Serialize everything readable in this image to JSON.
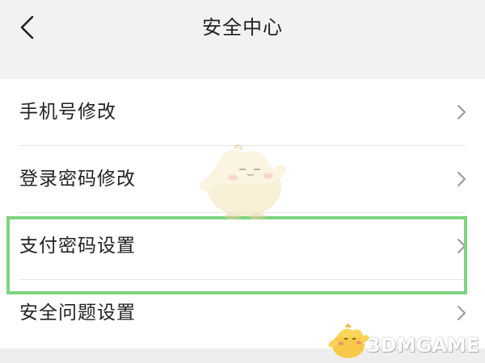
{
  "header": {
    "title": "安全中心",
    "back_icon": "chevron-left-icon"
  },
  "menu": {
    "items": [
      {
        "label": "手机号修改",
        "icon": "chevron-right-icon"
      },
      {
        "label": "登录密码修改",
        "icon": "chevron-right-icon"
      },
      {
        "label": "支付密码设置",
        "icon": "chevron-right-icon",
        "highlighted": true
      },
      {
        "label": "安全问题设置",
        "icon": "chevron-right-icon"
      }
    ]
  },
  "watermark": {
    "text": "3DMGAME"
  },
  "colors": {
    "background": "#f2f2f2",
    "row_background": "#ffffff",
    "highlight_border": "#7fd47f",
    "chevron": "#999999",
    "text": "#222222"
  }
}
